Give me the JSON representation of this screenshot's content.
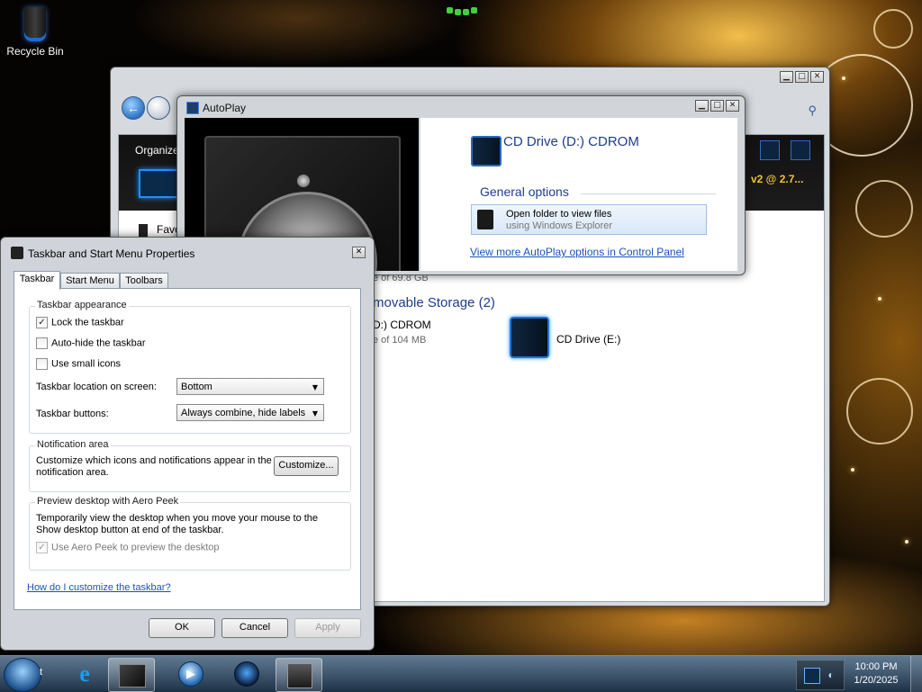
{
  "desktop": {
    "recycle_bin_label": "Recycle Bin"
  },
  "explorer": {
    "organize_label": "Organize",
    "favorites_label": "Favo",
    "processor_label": "v2 @ 2.7...",
    "partial_free": "e of 69.8 GB",
    "section_header": "movable Storage (2)",
    "drive_d_name": "D:) CDROM",
    "drive_d_free": "e of 104 MB",
    "drive_e_name": "CD Drive (E:)"
  },
  "autoplay": {
    "title": "AutoPlay",
    "drive_title": "CD Drive (D:) CDROM",
    "group_title": "General options",
    "option_main": "Open folder to view files",
    "option_sub": "using Windows Explorer",
    "more_link": "View more AutoPlay options in Control Panel"
  },
  "props": {
    "title": "Taskbar and Start Menu Properties",
    "tabs": [
      "Taskbar",
      "Start Menu",
      "Toolbars"
    ],
    "appearance_group": "Taskbar appearance",
    "lock_taskbar": "Lock the taskbar",
    "lock_checked": true,
    "auto_hide": "Auto-hide the taskbar",
    "small_icons": "Use small icons",
    "location_label": "Taskbar location on screen:",
    "location_value": "Bottom",
    "buttons_label": "Taskbar buttons:",
    "buttons_value": "Always combine, hide labels",
    "notification_group": "Notification area",
    "notification_text": "Customize which icons and notifications appear in the notification area.",
    "customize_button": "Customize...",
    "peek_group": "Preview desktop with Aero Peek",
    "peek_text": "Temporarily view the desktop when you move your mouse to the Show desktop button at end of the taskbar.",
    "peek_checkbox": "Use Aero Peek to preview the desktop",
    "help_link": "How do I customize the taskbar?",
    "ok": "OK",
    "cancel": "Cancel",
    "apply": "Apply"
  },
  "taskbar": {
    "start_suffix": "t",
    "clock_time": "10:00 PM",
    "clock_date": "1/20/2025"
  }
}
